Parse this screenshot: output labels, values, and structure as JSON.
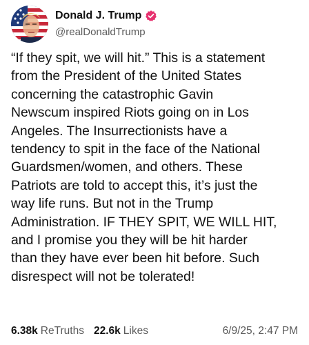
{
  "author": {
    "display_name": "Donald J. Trump",
    "handle": "@realDonaldTrump",
    "avatar_icon": "profile-photo-flag-avatar",
    "verified_icon": "verified-badge-icon",
    "verified_color": "#e7316f"
  },
  "post": {
    "text": "“If they spit, we will hit.” This is a statement\nfrom the President of the United States\nconcerning the catastrophic Gavin\nNewscum inspired Riots going on in Los\nAngeles. The Insurrectionists have a\ntendency to spit in the face of the National\nGuardsmen/women, and others. These\nPatriots are told to accept this, it’s just the\nway life runs. But not in the Trump\nAdministration. IF THEY SPIT, WE WILL HIT,\nand I promise you they will be hit harder\nthan they have ever been hit before. Such\ndisrespect will not be tolerated!"
  },
  "stats": {
    "retruths_count": "6.38k",
    "retruths_label": "ReTruths",
    "likes_count": "22.6k",
    "likes_label": "Likes",
    "timestamp": "6/9/25, 2:47 PM"
  }
}
